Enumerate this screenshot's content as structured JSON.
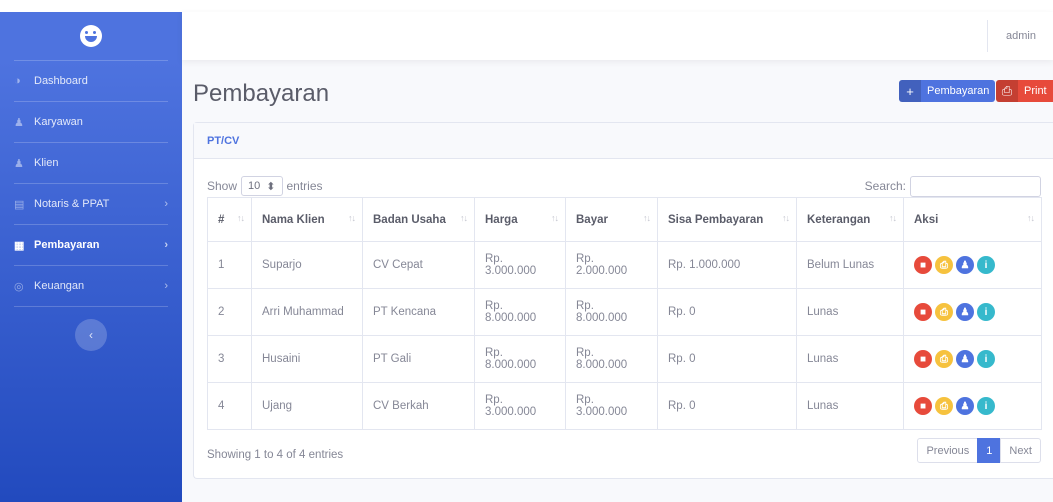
{
  "user": "admin",
  "sidebar": {
    "items": [
      {
        "label": "Dashboard",
        "icon": "palette-icon",
        "glyph": "◑",
        "arrow": ""
      },
      {
        "label": "Karyawan",
        "icon": "user-icon",
        "glyph": "♟",
        "arrow": ""
      },
      {
        "label": "Klien",
        "icon": "user-plus-icon",
        "glyph": "♟",
        "arrow": ""
      },
      {
        "label": "Notaris & PPAT",
        "icon": "book-icon",
        "glyph": "▤",
        "arrow": "›"
      },
      {
        "label": "Pembayaran",
        "icon": "money-icon",
        "glyph": "▦",
        "arrow": "›"
      },
      {
        "label": "Keuangan",
        "icon": "coin-icon",
        "glyph": "◎",
        "arrow": "›"
      }
    ],
    "toggle_glyph": "‹"
  },
  "page": {
    "title": "Pembayaran",
    "add_button": {
      "glyph": "+",
      "label": "Pembayaran"
    },
    "print_button": {
      "glyph": "⎙",
      "label": "Print"
    }
  },
  "card": {
    "title": "PT/CV",
    "show_label": "Show",
    "entries_value": "10",
    "entries_glyph": "⬍",
    "entries_label": "entries",
    "search_label": "Search:",
    "columns": [
      "#",
      "Nama Klien",
      "Badan Usaha",
      "Harga",
      "Bayar",
      "Sisa Pembayaran",
      "Keterangan",
      "Aksi"
    ],
    "sort_glyph": "↑↓",
    "rows": [
      {
        "no": "1",
        "nama": "Suparjo",
        "badan": "CV Cepat",
        "harga": "Rp. 3.000.000",
        "bayar": "Rp. 2.000.000",
        "sisa": "Rp. 1.000.000",
        "ket": "Belum Lunas"
      },
      {
        "no": "2",
        "nama": "Arri Muhammad",
        "badan": "PT Kencana",
        "harga": "Rp. 8.000.000",
        "bayar": "Rp. 8.000.000",
        "sisa": "Rp. 0",
        "ket": "Lunas"
      },
      {
        "no": "3",
        "nama": "Husaini",
        "badan": "PT Gali",
        "harga": "Rp. 8.000.000",
        "bayar": "Rp. 8.000.000",
        "sisa": "Rp. 0",
        "ket": "Lunas"
      },
      {
        "no": "4",
        "nama": "Ujang",
        "badan": "CV Berkah",
        "harga": "Rp. 3.000.000",
        "bayar": "Rp. 3.000.000",
        "sisa": "Rp. 0",
        "ket": "Lunas"
      }
    ],
    "actions": [
      {
        "name": "delete-icon",
        "glyph": "■",
        "color": "red"
      },
      {
        "name": "print-icon",
        "glyph": "⎙",
        "color": "yellow"
      },
      {
        "name": "user-edit-icon",
        "glyph": "♟",
        "color": "blue"
      },
      {
        "name": "info-icon",
        "glyph": "i",
        "color": "teal"
      }
    ],
    "info_text": "Showing 1 to 4 of 4 entries",
    "pagination": {
      "previous": "Previous",
      "current": "1",
      "next": "Next"
    }
  },
  "colors": {
    "primary": "#4e73df",
    "danger": "#e74a3b",
    "warning": "#f6c23e",
    "info": "#36b9cc"
  }
}
